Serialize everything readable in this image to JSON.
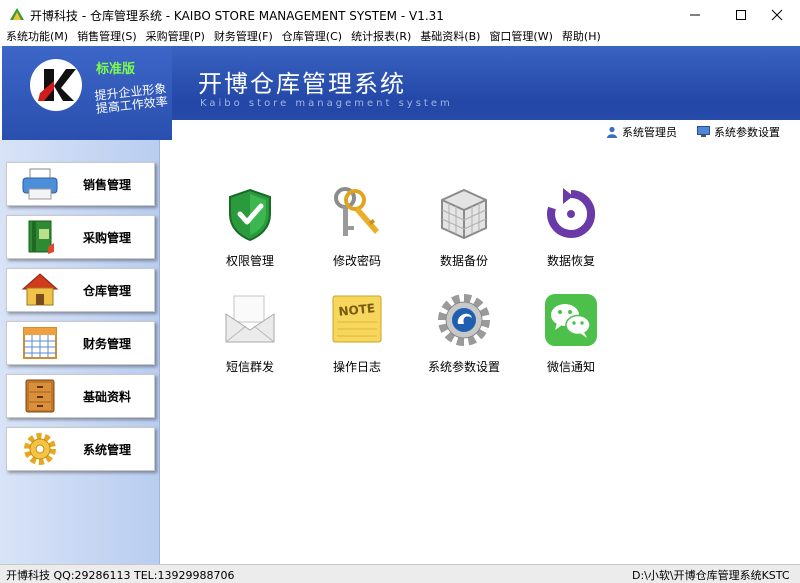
{
  "window": {
    "title": "开博科技 - 仓库管理系统 - KAIBO STORE MANAGEMENT SYSTEM - V1.31"
  },
  "menu": [
    {
      "label": "系统功能(M)"
    },
    {
      "label": "销售管理(S)"
    },
    {
      "label": "采购管理(P)"
    },
    {
      "label": "财务管理(F)"
    },
    {
      "label": "仓库管理(C)"
    },
    {
      "label": "统计报表(R)"
    },
    {
      "label": "基础资料(B)"
    },
    {
      "label": "窗口管理(W)"
    },
    {
      "label": "帮助(H)"
    }
  ],
  "banner": {
    "edition": "标准版",
    "slogan_line1": "提升企业形象",
    "slogan_line2": "提高工作效率",
    "title": "开博仓库管理系统",
    "subtitle": "Kaibo store management system",
    "user_label": "系统管理员",
    "settings_label": "系统参数设置"
  },
  "sidebar": [
    {
      "label": "销售管理",
      "icon": "printer-icon"
    },
    {
      "label": "采购管理",
      "icon": "book-icon"
    },
    {
      "label": "仓库管理",
      "icon": "house-icon"
    },
    {
      "label": "财务管理",
      "icon": "calendar-icon"
    },
    {
      "label": "基础资料",
      "icon": "cabinet-icon"
    },
    {
      "label": "系统管理",
      "icon": "gear-icon"
    }
  ],
  "tiles": [
    {
      "label": "权限管理",
      "icon": "shield-check-icon"
    },
    {
      "label": "修改密码",
      "icon": "keys-icon"
    },
    {
      "label": "数据备份",
      "icon": "cube-icon"
    },
    {
      "label": "数据恢复",
      "icon": "restore-icon"
    },
    {
      "label": "短信群发",
      "icon": "envelope-icon"
    },
    {
      "label": "操作日志",
      "icon": "note-icon"
    },
    {
      "label": "系统参数设置",
      "icon": "gear-icon"
    },
    {
      "label": "微信通知",
      "icon": "wechat-icon"
    }
  ],
  "status": {
    "left": "开博科技  QQ:29286113  TEL:13929988706",
    "right": "D:\\小软\\开博仓库管理系统KSTC"
  },
  "colors": {
    "banner": "#2347a6",
    "edition": "#7cfc4c",
    "sidebar": "#c6d6f3"
  }
}
